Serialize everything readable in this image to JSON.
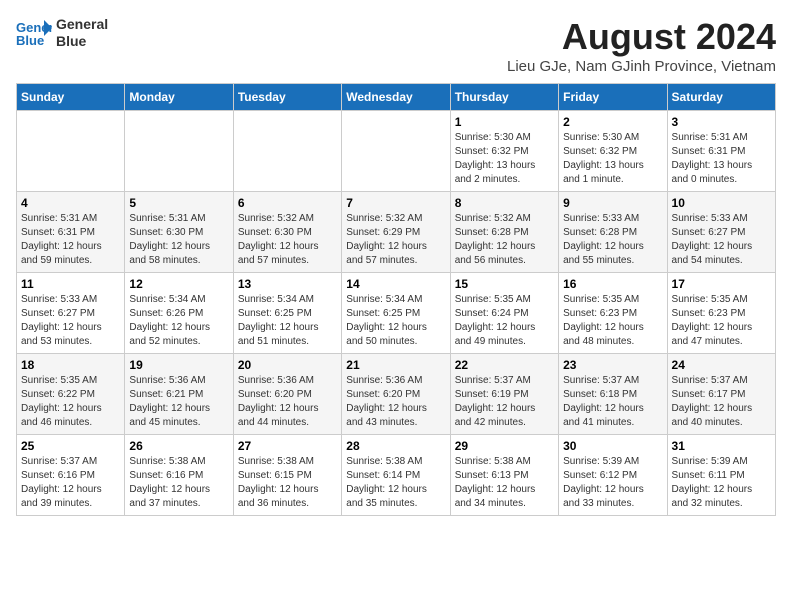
{
  "logo": {
    "line1": "General",
    "line2": "Blue"
  },
  "title": "August 2024",
  "subtitle": "Lieu GJe, Nam GJinh Province, Vietnam",
  "days_of_week": [
    "Sunday",
    "Monday",
    "Tuesday",
    "Wednesday",
    "Thursday",
    "Friday",
    "Saturday"
  ],
  "weeks": [
    [
      {
        "day": "",
        "info": ""
      },
      {
        "day": "",
        "info": ""
      },
      {
        "day": "",
        "info": ""
      },
      {
        "day": "",
        "info": ""
      },
      {
        "day": "1",
        "info": "Sunrise: 5:30 AM\nSunset: 6:32 PM\nDaylight: 13 hours\nand 2 minutes."
      },
      {
        "day": "2",
        "info": "Sunrise: 5:30 AM\nSunset: 6:32 PM\nDaylight: 13 hours\nand 1 minute."
      },
      {
        "day": "3",
        "info": "Sunrise: 5:31 AM\nSunset: 6:31 PM\nDaylight: 13 hours\nand 0 minutes."
      }
    ],
    [
      {
        "day": "4",
        "info": "Sunrise: 5:31 AM\nSunset: 6:31 PM\nDaylight: 12 hours\nand 59 minutes."
      },
      {
        "day": "5",
        "info": "Sunrise: 5:31 AM\nSunset: 6:30 PM\nDaylight: 12 hours\nand 58 minutes."
      },
      {
        "day": "6",
        "info": "Sunrise: 5:32 AM\nSunset: 6:30 PM\nDaylight: 12 hours\nand 57 minutes."
      },
      {
        "day": "7",
        "info": "Sunrise: 5:32 AM\nSunset: 6:29 PM\nDaylight: 12 hours\nand 57 minutes."
      },
      {
        "day": "8",
        "info": "Sunrise: 5:32 AM\nSunset: 6:28 PM\nDaylight: 12 hours\nand 56 minutes."
      },
      {
        "day": "9",
        "info": "Sunrise: 5:33 AM\nSunset: 6:28 PM\nDaylight: 12 hours\nand 55 minutes."
      },
      {
        "day": "10",
        "info": "Sunrise: 5:33 AM\nSunset: 6:27 PM\nDaylight: 12 hours\nand 54 minutes."
      }
    ],
    [
      {
        "day": "11",
        "info": "Sunrise: 5:33 AM\nSunset: 6:27 PM\nDaylight: 12 hours\nand 53 minutes."
      },
      {
        "day": "12",
        "info": "Sunrise: 5:34 AM\nSunset: 6:26 PM\nDaylight: 12 hours\nand 52 minutes."
      },
      {
        "day": "13",
        "info": "Sunrise: 5:34 AM\nSunset: 6:25 PM\nDaylight: 12 hours\nand 51 minutes."
      },
      {
        "day": "14",
        "info": "Sunrise: 5:34 AM\nSunset: 6:25 PM\nDaylight: 12 hours\nand 50 minutes."
      },
      {
        "day": "15",
        "info": "Sunrise: 5:35 AM\nSunset: 6:24 PM\nDaylight: 12 hours\nand 49 minutes."
      },
      {
        "day": "16",
        "info": "Sunrise: 5:35 AM\nSunset: 6:23 PM\nDaylight: 12 hours\nand 48 minutes."
      },
      {
        "day": "17",
        "info": "Sunrise: 5:35 AM\nSunset: 6:23 PM\nDaylight: 12 hours\nand 47 minutes."
      }
    ],
    [
      {
        "day": "18",
        "info": "Sunrise: 5:35 AM\nSunset: 6:22 PM\nDaylight: 12 hours\nand 46 minutes."
      },
      {
        "day": "19",
        "info": "Sunrise: 5:36 AM\nSunset: 6:21 PM\nDaylight: 12 hours\nand 45 minutes."
      },
      {
        "day": "20",
        "info": "Sunrise: 5:36 AM\nSunset: 6:20 PM\nDaylight: 12 hours\nand 44 minutes."
      },
      {
        "day": "21",
        "info": "Sunrise: 5:36 AM\nSunset: 6:20 PM\nDaylight: 12 hours\nand 43 minutes."
      },
      {
        "day": "22",
        "info": "Sunrise: 5:37 AM\nSunset: 6:19 PM\nDaylight: 12 hours\nand 42 minutes."
      },
      {
        "day": "23",
        "info": "Sunrise: 5:37 AM\nSunset: 6:18 PM\nDaylight: 12 hours\nand 41 minutes."
      },
      {
        "day": "24",
        "info": "Sunrise: 5:37 AM\nSunset: 6:17 PM\nDaylight: 12 hours\nand 40 minutes."
      }
    ],
    [
      {
        "day": "25",
        "info": "Sunrise: 5:37 AM\nSunset: 6:16 PM\nDaylight: 12 hours\nand 39 minutes."
      },
      {
        "day": "26",
        "info": "Sunrise: 5:38 AM\nSunset: 6:16 PM\nDaylight: 12 hours\nand 37 minutes."
      },
      {
        "day": "27",
        "info": "Sunrise: 5:38 AM\nSunset: 6:15 PM\nDaylight: 12 hours\nand 36 minutes."
      },
      {
        "day": "28",
        "info": "Sunrise: 5:38 AM\nSunset: 6:14 PM\nDaylight: 12 hours\nand 35 minutes."
      },
      {
        "day": "29",
        "info": "Sunrise: 5:38 AM\nSunset: 6:13 PM\nDaylight: 12 hours\nand 34 minutes."
      },
      {
        "day": "30",
        "info": "Sunrise: 5:39 AM\nSunset: 6:12 PM\nDaylight: 12 hours\nand 33 minutes."
      },
      {
        "day": "31",
        "info": "Sunrise: 5:39 AM\nSunset: 6:11 PM\nDaylight: 12 hours\nand 32 minutes."
      }
    ]
  ]
}
